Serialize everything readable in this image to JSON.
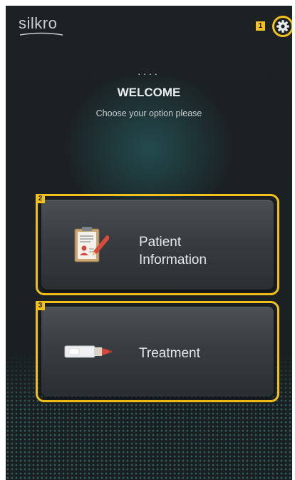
{
  "app": {
    "logo_text": "silkro"
  },
  "settings": {
    "badge": "1",
    "icon": "gear-icon"
  },
  "welcome": {
    "dots": "....",
    "title": "WELCOME",
    "subtitle": "Choose your option please"
  },
  "options": [
    {
      "badge": "2",
      "label_line1": "Patient",
      "label_line2": "Information",
      "icon": "clipboard-icon"
    },
    {
      "badge": "3",
      "label": "Treatment",
      "icon": "syringe-icon"
    }
  ],
  "colors": {
    "highlight": "#f2c11b",
    "background": "#1c2123",
    "accent": "#2a6e73"
  }
}
